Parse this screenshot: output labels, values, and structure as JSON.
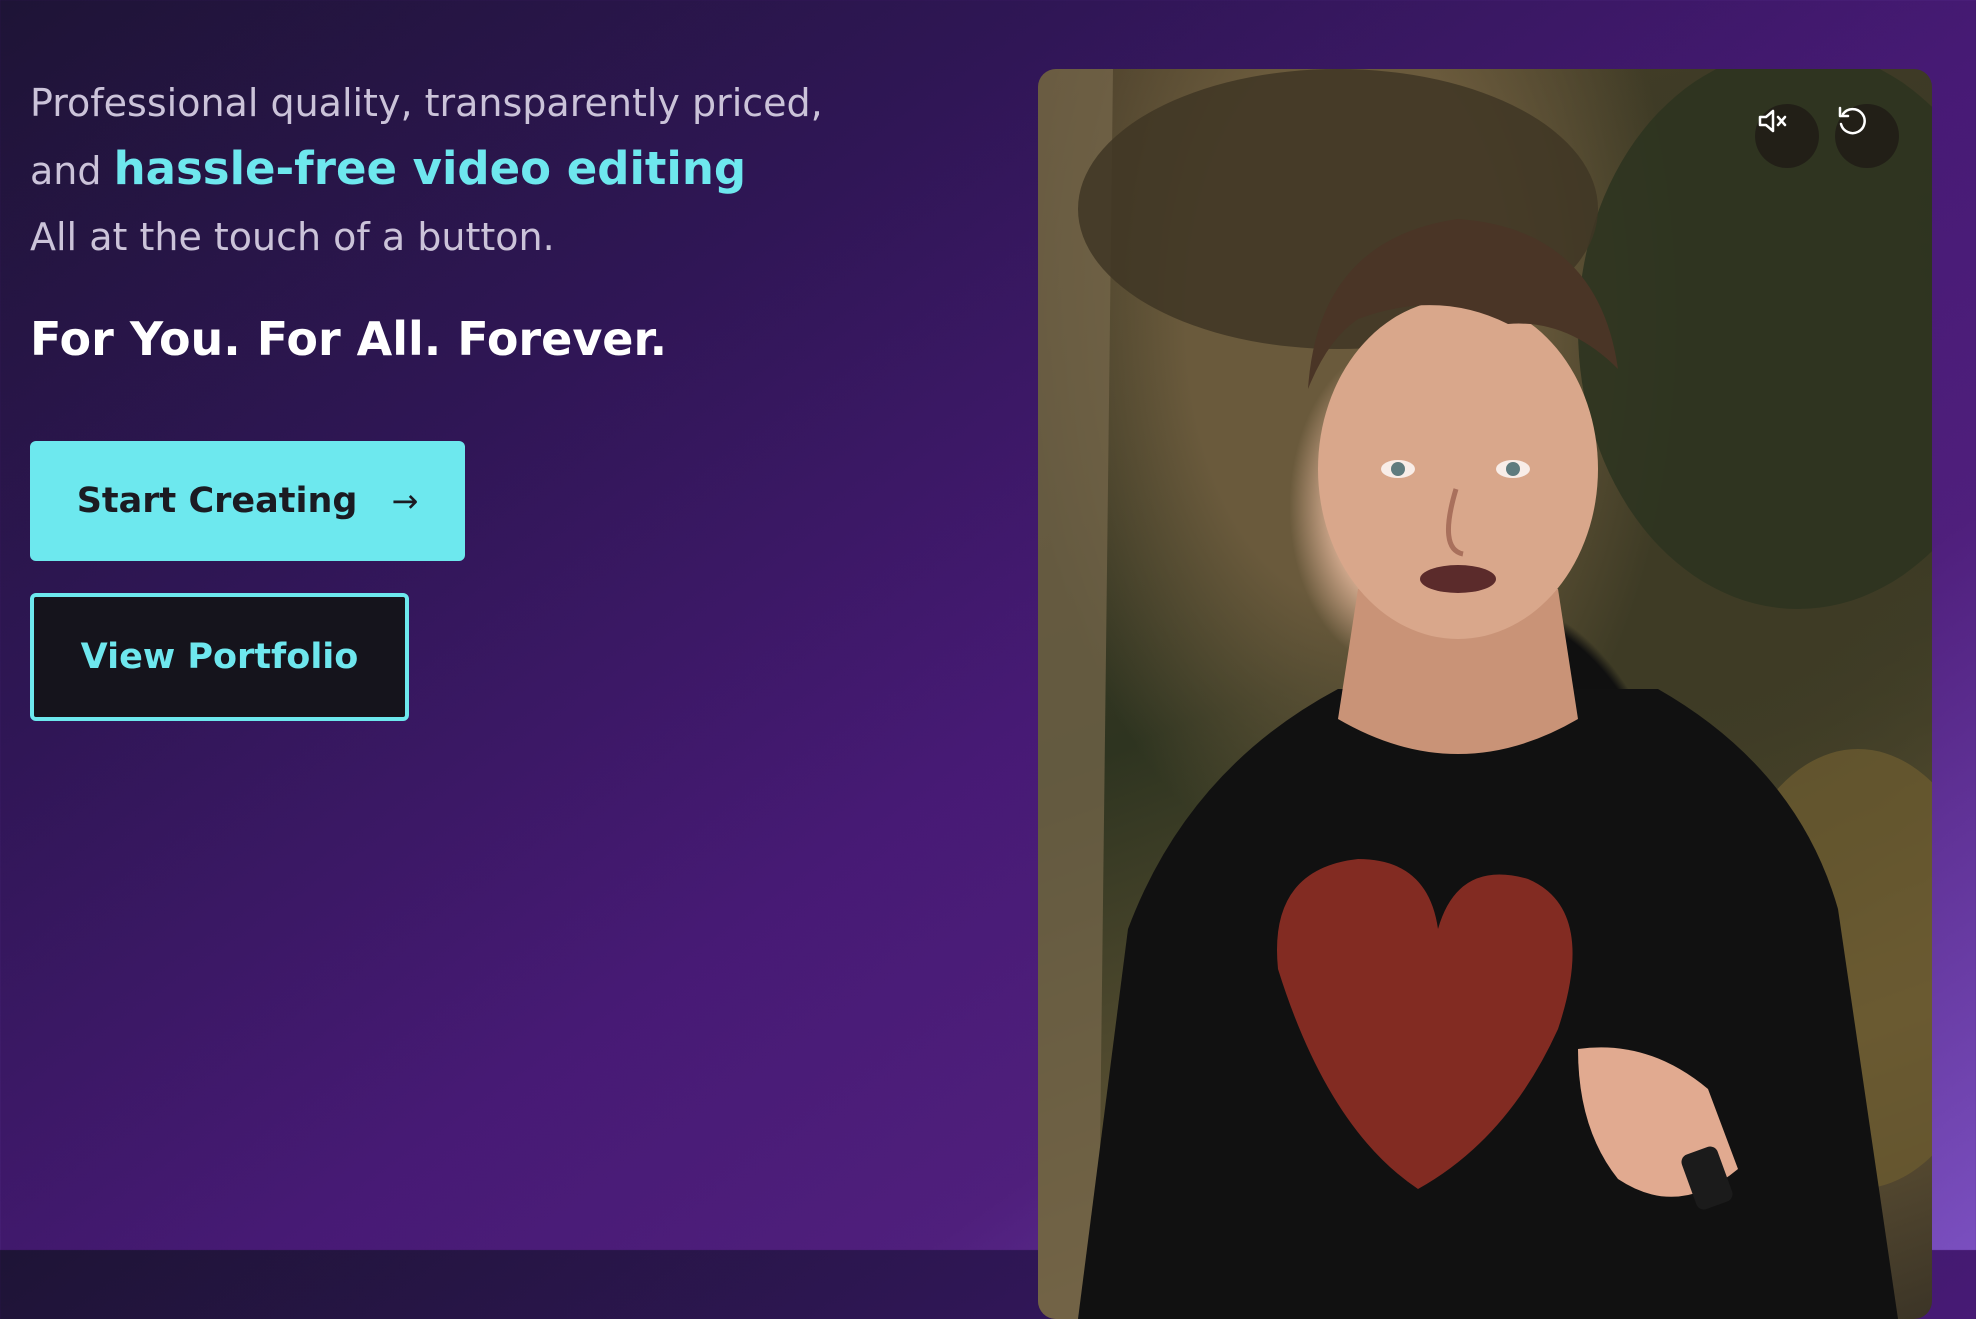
{
  "hero": {
    "line1": "Professional quality, transparently priced,",
    "line2_prefix": "and",
    "line2_accent": "hassle-free video editing",
    "line3": "All at the touch of a button.",
    "tagline": "For You. For All. Forever."
  },
  "buttons": {
    "primary_label": "Start Creating",
    "primary_icon": "arrow-right-icon",
    "secondary_label": "View Portfolio"
  },
  "video": {
    "controls": {
      "mute_icon": "volume-muted-icon",
      "replay_icon": "replay-icon"
    }
  },
  "colors": {
    "accent": "#6ee7ee",
    "button_primary_bg": "#6de8ee",
    "button_secondary_bg": "#15141c"
  }
}
